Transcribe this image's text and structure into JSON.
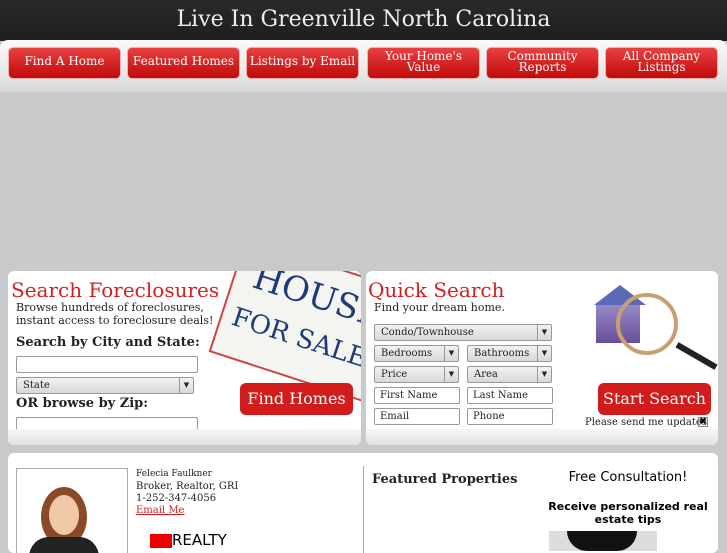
{
  "header": {
    "title": "Live In Greenville North Carolina"
  },
  "nav": [
    "Find A Home",
    "Featured Homes",
    "Listings by Email",
    "Your Home's Value",
    "Community Reports",
    "All Company Listings"
  ],
  "foreclosures": {
    "title": "Search Foreclosures",
    "desc1": "Browse hundreds of foreclosures,",
    "desc2": "instant access to foreclosure deals!",
    "city_label": "Search by City and State:",
    "city_value": "",
    "state_select": "State",
    "zip_label": "OR browse by Zip:",
    "zip_value": "",
    "button": "Find Homes",
    "sign_text1": "HOUSE",
    "sign_text2": "FOR SALE"
  },
  "quick": {
    "title": "Quick Search",
    "subtitle": "Find your dream home.",
    "type_select": "Condo/Townhouse",
    "bedrooms": "Bedrooms",
    "bathrooms": "Bathrooms",
    "price": "Price",
    "area": "Area",
    "first_name": "First Name",
    "last_name": "Last Name",
    "email": "Email",
    "phone": "Phone",
    "button": "Start Search",
    "updates_label": "Please send me updates",
    "updates_checked": true
  },
  "agent": {
    "name": "Felecia Faulkner",
    "title": "Broker, Realtor, GRI",
    "phone": "1-252-347-4056",
    "email_link": "Email Me",
    "logo_text": "REALTY"
  },
  "featured": {
    "title": "Featured Properties"
  },
  "consult": {
    "title": "Free Consultation!",
    "subtitle": "Receive personalized real estate tips"
  },
  "colors": {
    "accent": "#d21c1c",
    "header_bg": "#242424",
    "page_bg": "#c9c9c9"
  }
}
